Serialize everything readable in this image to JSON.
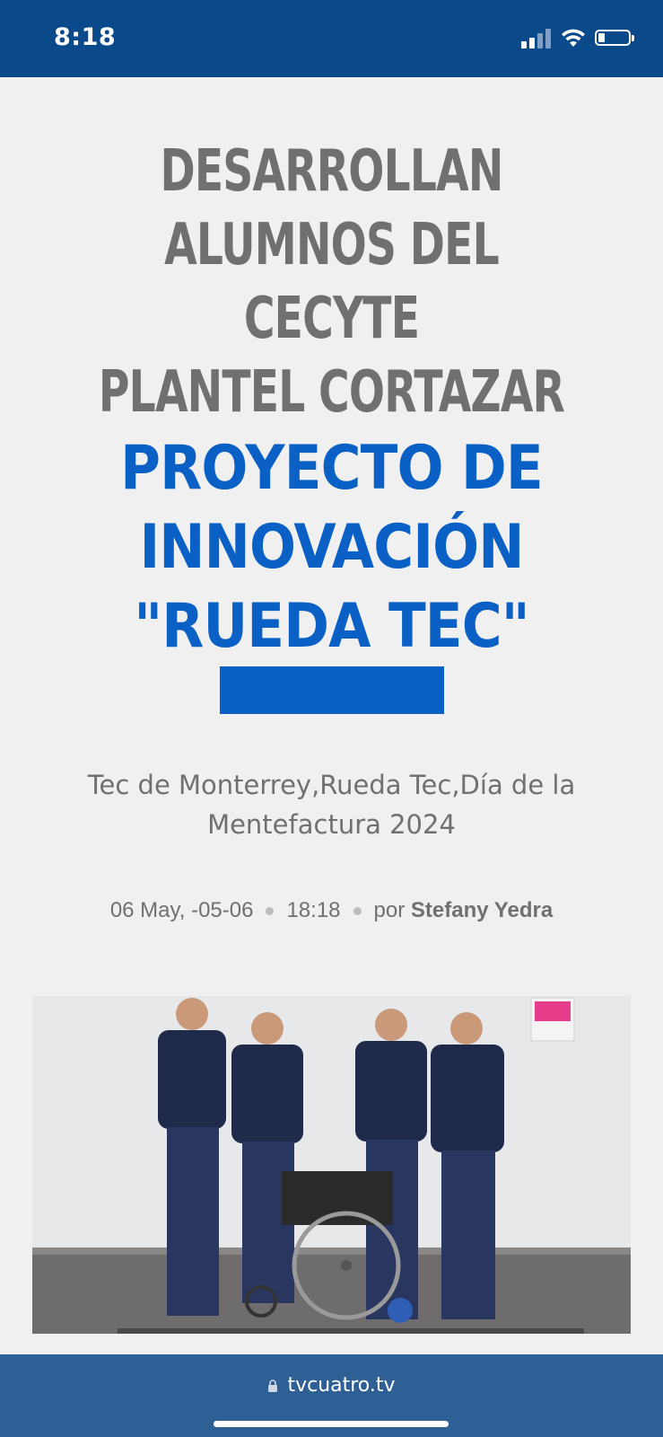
{
  "status_bar": {
    "time": "8:18",
    "background": "#0a4a8a"
  },
  "article": {
    "headline_lines_grey": [
      "DESARROLLAN",
      "ALUMNOS DEL CECYTE",
      "PLANTEL CORTAZAR"
    ],
    "headline_lines_blue": [
      "PROYECTO DE",
      "INNOVACIÓN",
      "\"RUEDA TEC\""
    ],
    "tags": "Tec de Monterrey,Rueda Tec,Día de la Mentefactura 2024",
    "date": "06 May, -05-06",
    "time": "18:18",
    "by_label": "por",
    "author": "Stefany Yedra",
    "accent_color": "#0a60c4",
    "photo_icon": "group-photo-students-wheelchair"
  },
  "browser": {
    "url": "tvcuatro.tv"
  }
}
